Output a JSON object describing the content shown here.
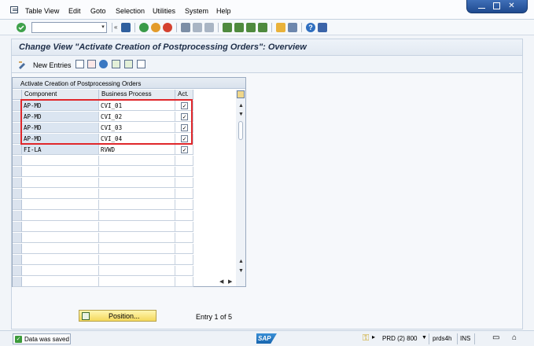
{
  "menu": {
    "items": [
      "Table View",
      "Edit",
      "Goto",
      "Selection",
      "Utilities",
      "System",
      "Help"
    ]
  },
  "toolbar": {
    "command_value": "",
    "icons": [
      "enter-icon",
      "save-icon",
      "back-icon",
      "exit-icon",
      "cancel-icon",
      "print-icon",
      "find-icon",
      "find-next-icon",
      "first-page-icon",
      "previous-page-icon",
      "next-page-icon",
      "last-page-icon",
      "new-session-icon",
      "shortcut-icon",
      "help-icon",
      "customize-icon"
    ]
  },
  "title": "Change View \"Activate Creation of Postprocessing Orders\": Overview",
  "app_toolbar": {
    "new_entries_label": "New Entries"
  },
  "table": {
    "title": "Activate Creation of Postprocessing Orders",
    "columns": [
      "Component",
      "Business Process",
      "Act."
    ],
    "rows": [
      {
        "component": "AP-MD",
        "business_process": "CVI_01",
        "active": true
      },
      {
        "component": "AP-MD",
        "business_process": "CVI_02",
        "active": true
      },
      {
        "component": "AP-MD",
        "business_process": "CVI_03",
        "active": true
      },
      {
        "component": "AP-MD",
        "business_process": "CVI_04",
        "active": true
      },
      {
        "component": "FI-LA",
        "business_process": "RVWD",
        "active": true
      }
    ],
    "empty_rows": 12
  },
  "position_button": "Position...",
  "entry_info": "Entry 1 of 5",
  "status": {
    "message": "Data was saved",
    "logo": "SAP",
    "system": "PRD (2) 800",
    "server": "prds4h",
    "mode": "INS"
  },
  "colors": {
    "highlight": "#e0272b",
    "title_text": "#20304a",
    "position_button": "#f4d85c"
  }
}
